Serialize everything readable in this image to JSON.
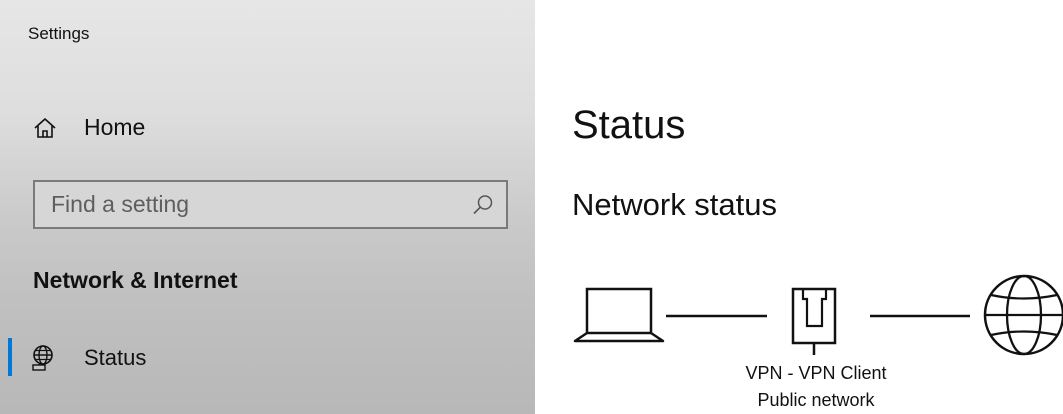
{
  "app": {
    "title": "Settings"
  },
  "sidebar": {
    "home_label": "Home",
    "search": {
      "placeholder": "Find a setting",
      "value": ""
    },
    "section_heading": "Network & Internet",
    "items": [
      {
        "label": "Status",
        "selected": true
      }
    ]
  },
  "main": {
    "title": "Status",
    "subheading": "Network status",
    "network": {
      "connection_name": "VPN - VPN Client",
      "network_type": "Public network"
    }
  },
  "colors": {
    "accent": "#0078d7"
  },
  "icons": [
    "home-icon",
    "search-icon",
    "globe-network-icon",
    "laptop-icon",
    "vpn-adapter-icon",
    "globe-icon"
  ]
}
